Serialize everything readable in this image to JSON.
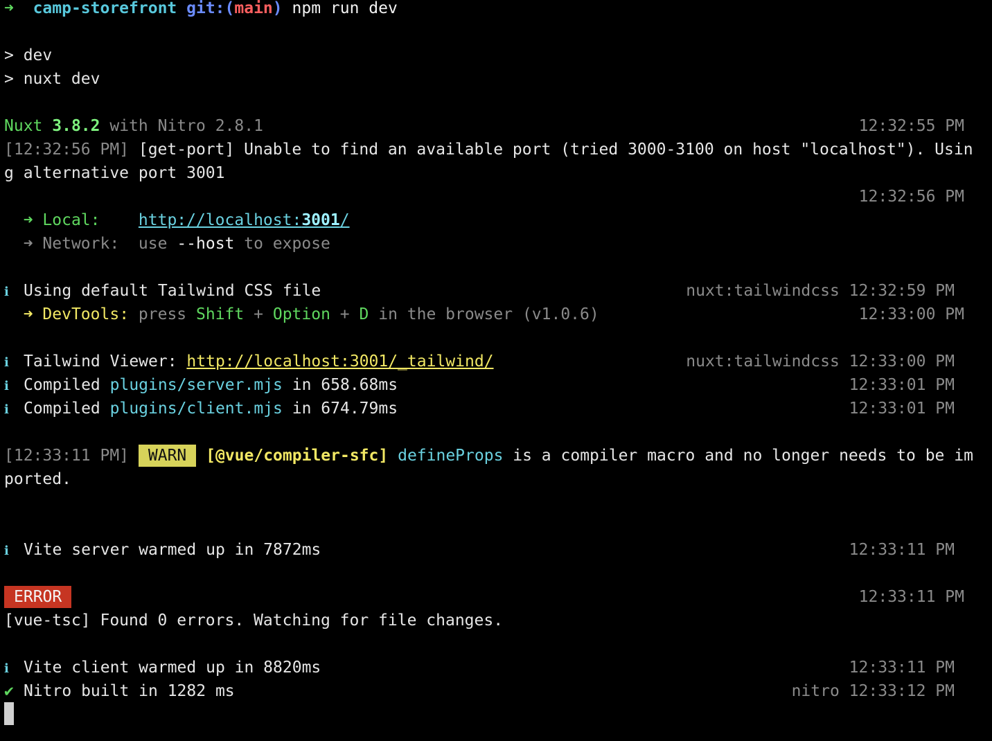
{
  "prompt": {
    "arrow": "➜",
    "directory": "camp-storefront",
    "git_prefix": "git:(",
    "branch": "main",
    "git_suffix": ")",
    "command": "npm run dev"
  },
  "script_lines": [
    "> dev",
    "> nuxt dev"
  ],
  "nuxt": {
    "name": "Nuxt",
    "version": "3.8.2",
    "with": "with Nitro",
    "nitro_version": "2.8.1",
    "time": "12:32:55 PM"
  },
  "getport": {
    "time_bracket": "[12:32:56 PM]",
    "text1": " [get-port] Unable to find an available port (tried 3000-3100 on host \"localhost\"). Usin",
    "text2": "g alternative port 3001",
    "time": "12:32:56 PM"
  },
  "local": {
    "arrow": "➜",
    "label": "Local:",
    "url_prefix": "http://localhost:",
    "url_port": "3001",
    "url_suffix": "/"
  },
  "network": {
    "arrow": "➜",
    "label": "Network:",
    "use": "use",
    "flag": "--host",
    "rest": "to expose"
  },
  "tailwind_default": {
    "icon": "ℹ",
    "text": "Using default Tailwind CSS file",
    "tag": "nuxt:tailwindcss",
    "time": "12:32:59 PM"
  },
  "devtools": {
    "arrow": "➜",
    "label": "DevTools:",
    "press": "press",
    "key1": "Shift",
    "plus1": "+",
    "key2": "Option",
    "plus2": "+",
    "key3": "D",
    "rest": "in the browser (v1.0.6)",
    "time": "12:33:00 PM"
  },
  "tailwind_viewer": {
    "icon": "ℹ",
    "label": "Tailwind Viewer:",
    "url": "http://localhost:3001/_tailwind/",
    "tag": "nuxt:tailwindcss",
    "time": "12:33:00 PM"
  },
  "compiled": [
    {
      "icon": "ℹ",
      "word": "Compiled",
      "file": "plugins/server.mjs",
      "rest": "in 658.68ms",
      "time": "12:33:01 PM"
    },
    {
      "icon": "ℹ",
      "word": "Compiled",
      "file": "plugins/client.mjs",
      "rest": "in 674.79ms",
      "time": "12:33:01 PM"
    }
  ],
  "warn": {
    "time_bracket": "[12:33:11 PM]",
    "badge": "WARN",
    "source": "[@vue/compiler-sfc]",
    "macro": "defineProps",
    "text1": " is a compiler macro and no longer needs to be im",
    "text2": "ported."
  },
  "vite_server": {
    "icon": "ℹ",
    "text": "Vite server warmed up in 7872ms",
    "time": "12:33:11 PM"
  },
  "error": {
    "badge": "ERROR",
    "time": "12:33:11 PM",
    "text": "[vue-tsc] Found 0 errors. Watching for file changes."
  },
  "vite_client": {
    "icon": "ℹ",
    "text": "Vite client warmed up in 8820ms",
    "time": "12:33:11 PM"
  },
  "nitro_built": {
    "icon": "✔",
    "text": "Nitro built in 1282 ms",
    "tag": "nitro",
    "time": "12:33:12 PM"
  }
}
